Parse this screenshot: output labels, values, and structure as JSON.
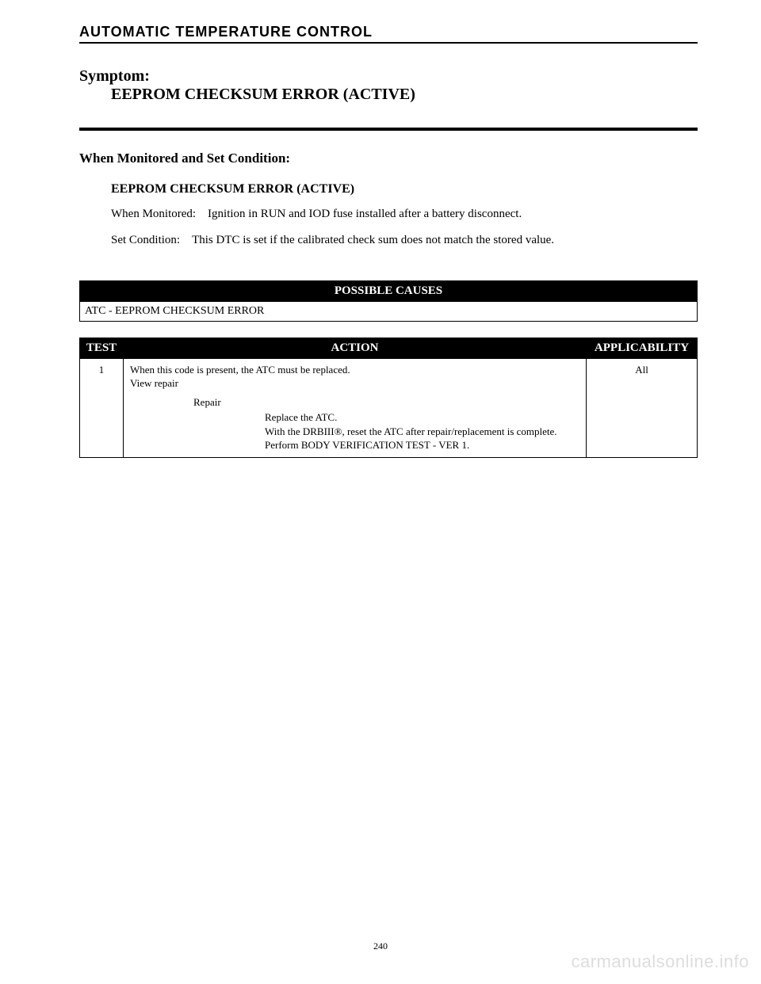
{
  "header": {
    "section_title": "AUTOMATIC TEMPERATURE CONTROL"
  },
  "symptom": {
    "label": "Symptom:",
    "name": "EEPROM CHECKSUM ERROR (ACTIVE)"
  },
  "conditions": {
    "heading": "When Monitored and Set Condition:",
    "subheading": "EEPROM CHECKSUM ERROR (ACTIVE)",
    "monitored": "When Monitored: Ignition in RUN and IOD fuse installed after a battery disconnect.",
    "set_condition": "Set Condition: This DTC is set if the calibrated check sum does not match the stored value."
  },
  "causes": {
    "header": "POSSIBLE CAUSES",
    "items": [
      "ATC - EEPROM CHECKSUM ERROR"
    ]
  },
  "test_table": {
    "headers": {
      "test": "TEST",
      "action": "ACTION",
      "applicability": "APPLICABILITY"
    },
    "rows": [
      {
        "test": "1",
        "action": {
          "line1": "When this code is present, the ATC must be replaced.",
          "line2": "View repair",
          "repair_label": "Repair",
          "repair_step1": "Replace the ATC.",
          "repair_step2": "With the DRBIII®, reset the ATC after repair/replacement is complete.",
          "repair_step3": "Perform BODY VERIFICATION TEST - VER 1."
        },
        "applicability": "All"
      }
    ]
  },
  "page_number": "240",
  "watermark": "carmanualsonline.info"
}
